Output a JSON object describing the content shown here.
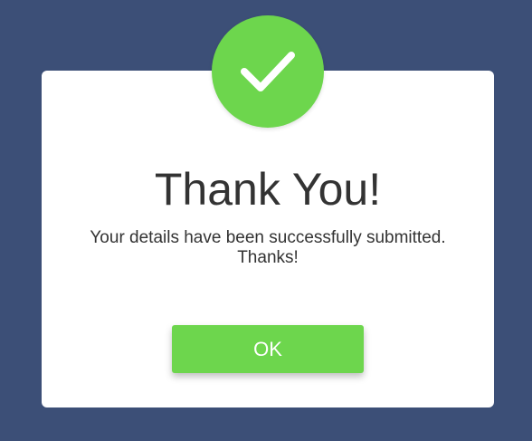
{
  "modal": {
    "icon": "checkmark-icon",
    "title": "Thank You!",
    "message": "Your details have been successfully submitted. Thanks!",
    "ok_label": "OK"
  },
  "colors": {
    "background": "#3c4f77",
    "accent": "#6dd64d",
    "card": "#ffffff",
    "text": "#333333"
  }
}
